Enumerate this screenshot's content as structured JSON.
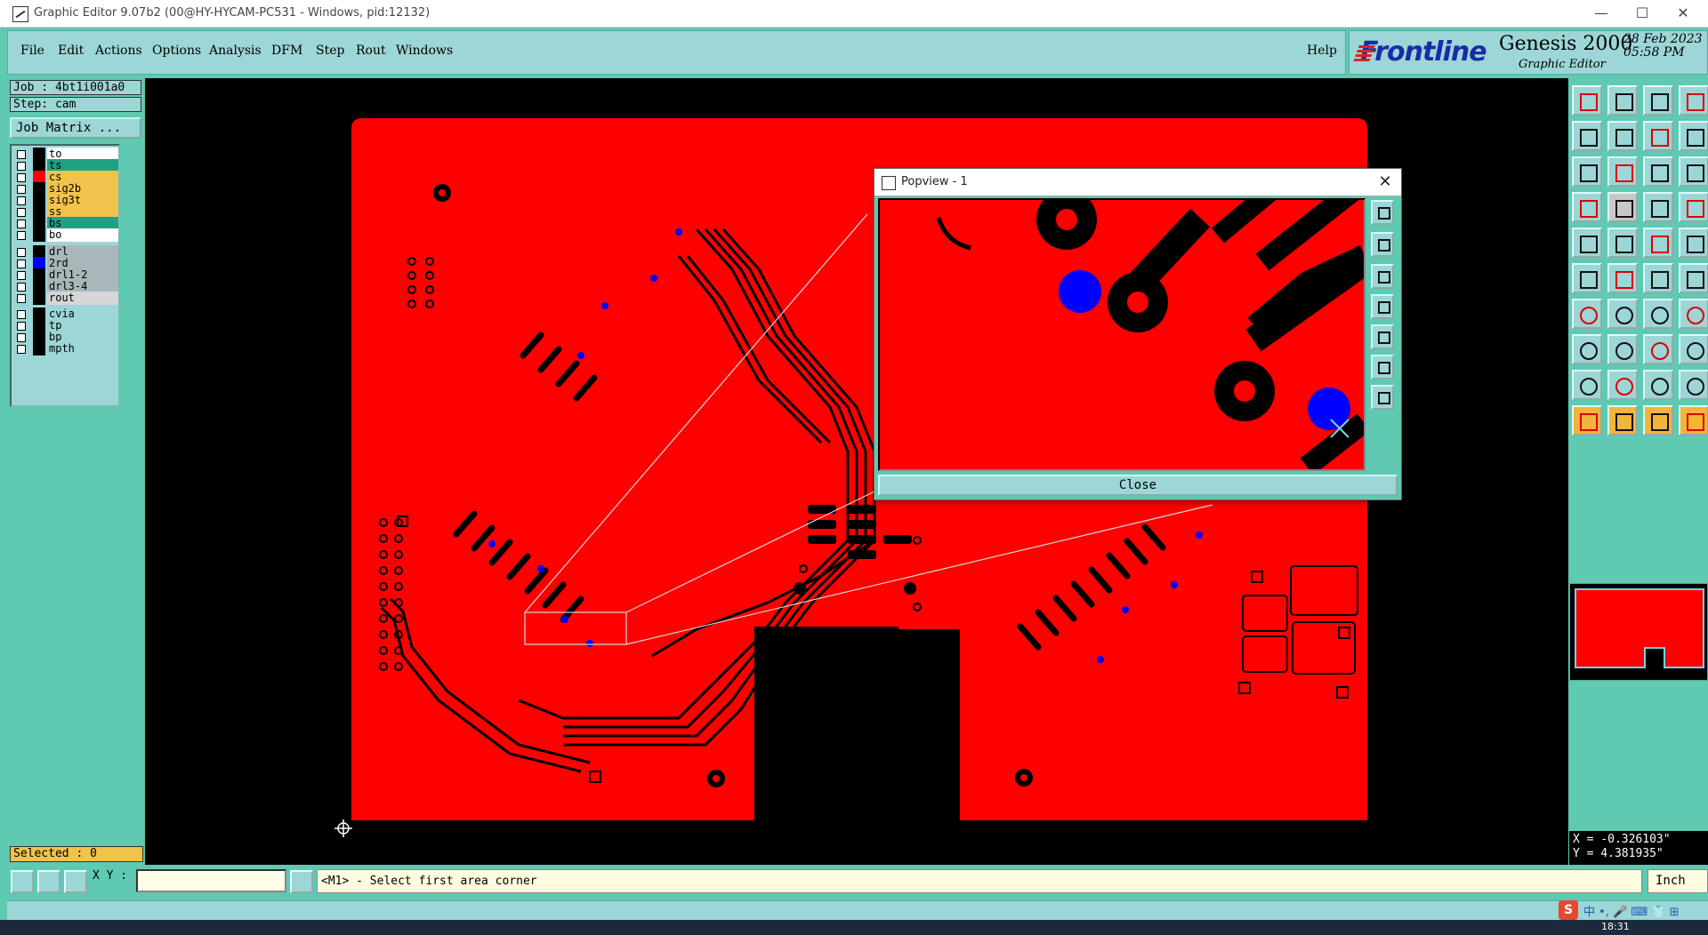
{
  "window": {
    "title": "Graphic Editor 9.07b2 (00@HY-HYCAM-PC531 - Windows, pid:12132)",
    "min_glyph": "—",
    "max_glyph": "☐",
    "close_glyph": "✕"
  },
  "menu": {
    "items": [
      "File",
      "Edit",
      "Actions",
      "Options",
      "Analysis",
      "DFM",
      "Step",
      "Rout",
      "Windows"
    ],
    "help": "Help"
  },
  "brand": {
    "logo": "Frontline",
    "product": "Genesis 2000",
    "module": "Graphic Editor",
    "date": "28 Feb 2023",
    "time": "05:58 PM"
  },
  "job": {
    "job_label": "Job : 4bt1i001a0",
    "step_label": "Step: cam",
    "matrix_button": "Job Matrix ..."
  },
  "layers": [
    {
      "name": "to",
      "color": "#ffffff",
      "swatch": "#000000"
    },
    {
      "name": "ts",
      "color": "#1fa184",
      "swatch": "#000000"
    },
    {
      "name": "cs",
      "color": "#f2c34a",
      "swatch": "#ff0000"
    },
    {
      "name": "sig2b",
      "color": "#f2c34a",
      "swatch": "#000000"
    },
    {
      "name": "sig3t",
      "color": "#f2c34a",
      "swatch": "#000000"
    },
    {
      "name": "ss",
      "color": "#f2c34a",
      "swatch": "#000000"
    },
    {
      "name": "bs",
      "color": "#1fa184",
      "swatch": "#000000"
    },
    {
      "name": "bo",
      "color": "#ffffff",
      "swatch": "#000000"
    },
    {
      "name": "drl",
      "color": "#a9b7bb",
      "swatch": "#000000"
    },
    {
      "name": "2rd",
      "color": "#a9b7bb",
      "swatch": "#0000ff"
    },
    {
      "name": "drl1-2",
      "color": "#a9b7bb",
      "swatch": "#000000"
    },
    {
      "name": "drl3-4",
      "color": "#a9b7bb",
      "swatch": "#000000"
    },
    {
      "name": "rout",
      "color": "#d6d6d6",
      "swatch": "#000000"
    },
    {
      "name": "cvia",
      "color": "#9dd6d6",
      "swatch": "#000000"
    },
    {
      "name": "tp",
      "color": "#9dd6d6",
      "swatch": "#000000"
    },
    {
      "name": "bp",
      "color": "#9dd6d6",
      "swatch": "#000000"
    },
    {
      "name": "mpth",
      "color": "#9dd6d6",
      "swatch": "#000000"
    }
  ],
  "selected": "Selected : 0",
  "popview": {
    "title": "Popview - 1",
    "close_button": "Close",
    "close_glyph": "✕"
  },
  "coords": {
    "x": "X = -0.326103\"",
    "y": "Y = 4.381935\""
  },
  "bottom": {
    "xy_label": "X Y :",
    "xy_value": "",
    "prompt": "<M1> - Select first area corner",
    "units": "Inch"
  },
  "ime": {
    "logo": "S",
    "text": "中 •, 🎤 ⌨ 👕 ⊞"
  },
  "taskbar": {
    "time": "18:31"
  },
  "colors": {
    "board": "#ff0000",
    "background": "#000000",
    "drill": "#0000ff",
    "chrome": "#5fc9b2",
    "panel": "#9dd6d6"
  }
}
